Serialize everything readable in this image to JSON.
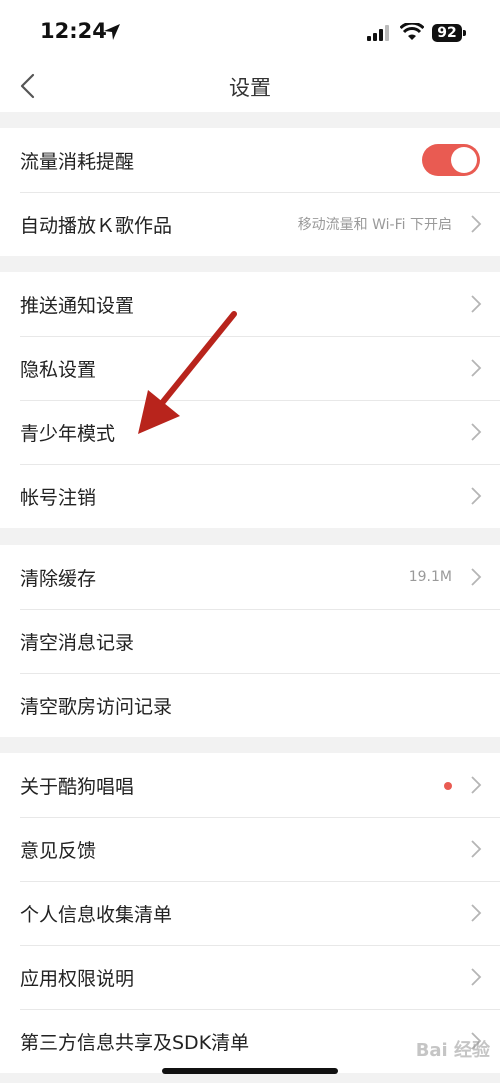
{
  "status_bar": {
    "time": "12:24",
    "battery": "92"
  },
  "nav": {
    "title": "设置"
  },
  "groups": [
    {
      "rows": [
        {
          "label": "流量消耗提醒",
          "toggle": true
        },
        {
          "label": "自动播放Ｋ歌作品",
          "value": "移动流量和 Wi-Fi 下开启"
        }
      ]
    },
    {
      "rows": [
        {
          "label": "推送通知设置"
        },
        {
          "label": "隐私设置"
        },
        {
          "label": "青少年模式"
        },
        {
          "label": "帐号注销"
        }
      ]
    },
    {
      "rows": [
        {
          "label": "清除缓存",
          "value": "19.1M"
        },
        {
          "label": "清空消息记录"
        },
        {
          "label": "清空歌房访问记录"
        }
      ]
    },
    {
      "rows": [
        {
          "label": "关于酷狗唱唱",
          "badge": true
        },
        {
          "label": "意见反馈"
        },
        {
          "label": "个人信息收集清单"
        },
        {
          "label": "应用权限说明"
        },
        {
          "label": "第三方信息共享及SDK清单"
        }
      ]
    }
  ],
  "colors": {
    "accent": "#e95b52",
    "annotation_arrow": "#b8241c"
  },
  "watermark": "Bai 经验"
}
